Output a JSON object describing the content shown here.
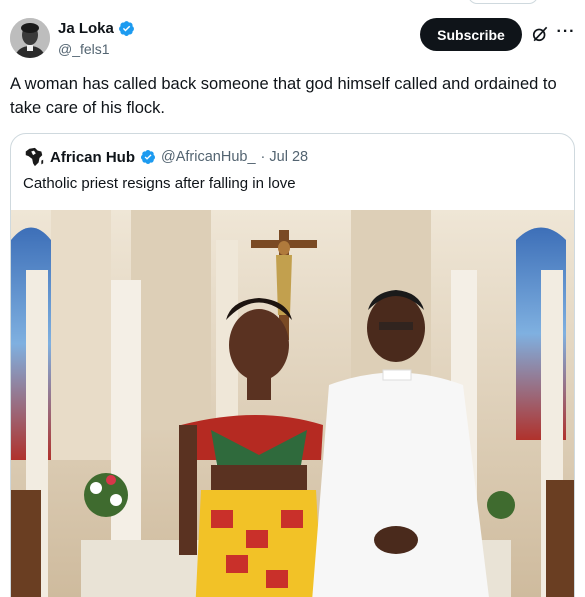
{
  "author": {
    "name": "Ja Loka",
    "handle": "@_fels1",
    "verified": true,
    "avatar_icon": "person-avatar"
  },
  "actions": {
    "subscribe_label": "Subscribe",
    "grok_icon": "grok-slash-icon",
    "more_icon": "more-dots-icon"
  },
  "tweet": {
    "text": "A woman has called back someone that god himself called and ordained to take care of his flock."
  },
  "quoted": {
    "name": "African Hub",
    "handle": "@AfricanHub_",
    "date": "· Jul 28",
    "verified": true,
    "logo_icon": "africa-map-logo",
    "text": "Catholic priest resigns after falling in love",
    "media_description_icon": "photo"
  },
  "colors": {
    "verified_blue": "#1d9bf0",
    "text_primary": "#0f1419",
    "text_secondary": "#536471",
    "border": "#cfd9de",
    "button_bg": "#0f1419"
  }
}
